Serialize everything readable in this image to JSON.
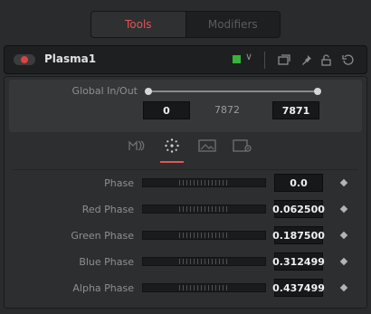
{
  "tabs": [
    {
      "label": "Tools",
      "active": true
    },
    {
      "label": "Modifiers",
      "active": false
    }
  ],
  "header": {
    "node_name": "Plasma1",
    "node_color": "#35b43a",
    "icons": [
      "version-icon",
      "pin-icon",
      "lock-icon",
      "reset-icon"
    ]
  },
  "global_inout": {
    "label": "Global In/Out",
    "in_value": "0",
    "mid_value": "7872",
    "out_value": "7871"
  },
  "control_tabs": [
    {
      "name": "circles-icon",
      "active": false
    },
    {
      "name": "dots-icon",
      "active": true
    },
    {
      "name": "image-icon",
      "active": false
    },
    {
      "name": "settings-icon",
      "active": false
    }
  ],
  "params": [
    {
      "label": "Phase",
      "value": "0.0"
    },
    {
      "label": "Red Phase",
      "value": "0.062500"
    },
    {
      "label": "Green Phase",
      "value": "0.187500"
    },
    {
      "label": "Blue Phase",
      "value": "0.312499"
    },
    {
      "label": "Alpha Phase",
      "value": "0.437499"
    }
  ],
  "colors": {
    "accent_red": "#e35454",
    "background": "#2a2b2d"
  }
}
